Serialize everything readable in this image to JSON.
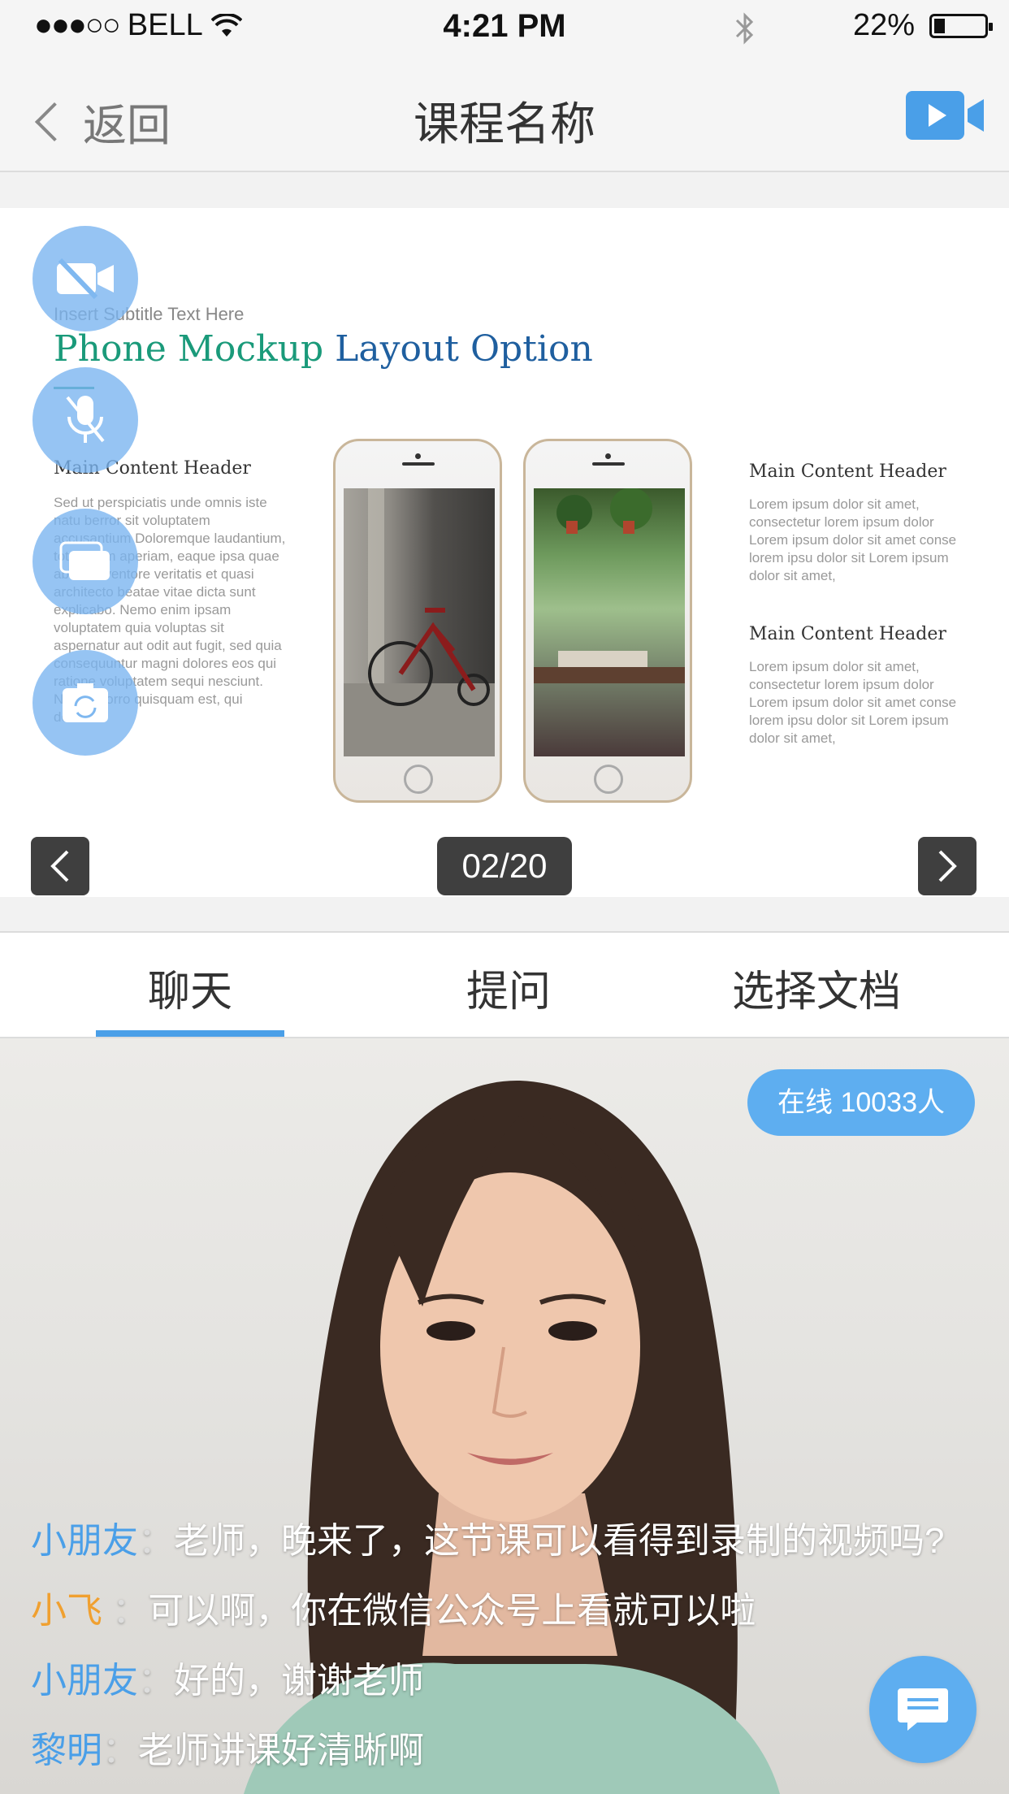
{
  "status_bar": {
    "signal": "●●●○○",
    "carrier": "BELL",
    "time": "4:21 PM",
    "battery_text": "22%",
    "battery_level": 0.22
  },
  "nav": {
    "back_label": "返回",
    "title": "课程名称"
  },
  "slide": {
    "subtitle": "Insert Subtitle Text Here",
    "title_part1": "Phone Mockup",
    "title_part2": "Layout Option",
    "left_header": "Main Content Header",
    "left_paragraph": "Sed ut perspiciatis unde omnis iste natu berror sit voluptatem accusantium Doloremque laudantium, totam rem aperiam, eaque ipsa quae ab illo inventore veritatis et quasi architecto beatae vitae dicta sunt explicabo. Nemo enim ipsam voluptatem quia voluptas sit aspernatur aut odit aut fugit, sed quia consequuntur magni dolores eos qui ratione voluptatem sequi nesciunt. Neque porro quisquam est, qui dolorem",
    "right_header_1": "Main Content Header",
    "right_paragraph_1": "Lorem ipsum dolor sit amet, consectetur lorem ipsum dolor Lorem ipsum dolor sit amet conse lorem ipsu dolor sit Lorem ipsum dolor sit amet,",
    "right_header_2": "Main Content Header",
    "right_paragraph_2": "Lorem ipsum dolor sit amet, consectetur lorem ipsum dolor Lorem ipsum dolor sit amet conse lorem ipsu dolor sit Lorem ipsum dolor sit amet,",
    "page_indicator": "02/20"
  },
  "tabs": [
    {
      "label": "聊天",
      "active": true
    },
    {
      "label": "提问",
      "active": false
    },
    {
      "label": "选择文档",
      "active": false
    }
  ],
  "online": {
    "label": "在线 10033人"
  },
  "chat": [
    {
      "name": "小朋友",
      "name_color": "#4a9fe8",
      "sep": "：",
      "text": "老师，晚来了，这节课可以看得到录制的视频吗?"
    },
    {
      "name": "小飞",
      "name_color": "#f0a030",
      "sep": " ：",
      "text": "可以啊，你在微信公众号上看就可以啦"
    },
    {
      "name": "小朋友",
      "name_color": "#4a9fe8",
      "sep": "：",
      "text": "好的，谢谢老师"
    },
    {
      "name": "黎明",
      "name_color": "#4a9fe8",
      "sep": "：",
      "text": "老师讲课好清晰啊"
    }
  ],
  "colors": {
    "accent": "#4a9fe8",
    "badge": "#5eaef0"
  }
}
